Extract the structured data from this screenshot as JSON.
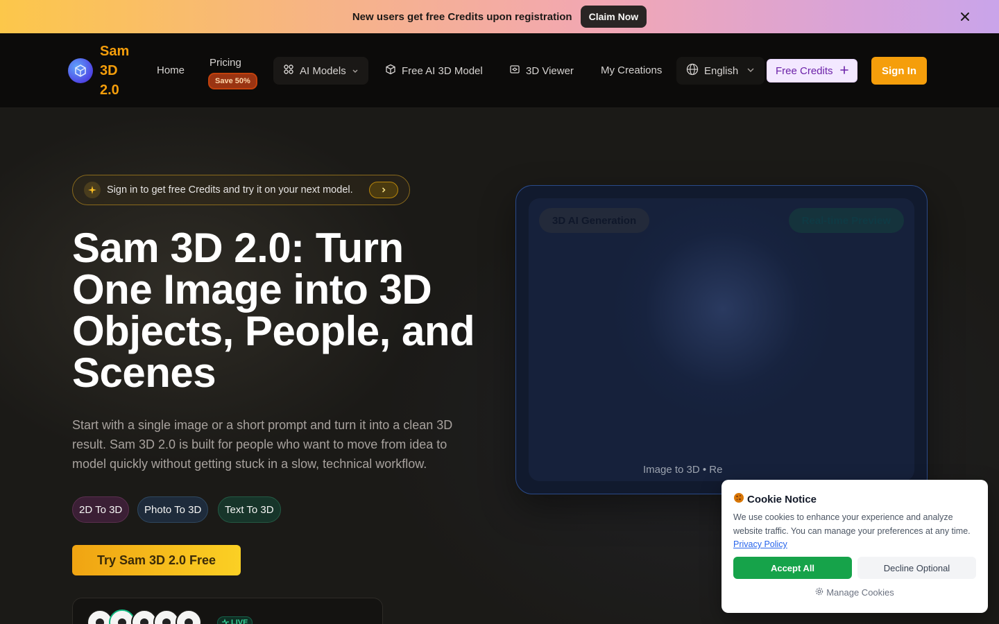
{
  "promo": {
    "text": "New users get free Credits upon registration",
    "button": "Claim Now"
  },
  "nav": {
    "brand_line1": "Sam",
    "brand_line2": "3D",
    "brand_line3": "2.0",
    "home": "Home",
    "pricing": "Pricing",
    "pricing_badge": "Save 50%",
    "ai_models": "AI Models",
    "free_model": "Free AI 3D Model",
    "viewer": "3D Viewer",
    "creations": "My Creations",
    "language": "English",
    "free_credits": "Free Credits",
    "sign_in": "Sign In"
  },
  "hero": {
    "signin_prompt": "Sign in to get free Credits and try it on your next model.",
    "title": "Sam 3D 2.0: Turn One Image into 3D Objects, People, and Scenes",
    "description": "Start with a single image or a short prompt and turn it into a clean 3D result. Sam 3D 2.0 is built for people who want to move from idea to model quickly without getting stuck in a slow, technical workflow.",
    "tags": [
      "2D To 3D",
      "Photo To 3D",
      "Text To 3D"
    ],
    "cta": "Try Sam 3D 2.0 Free",
    "live": "LIVE"
  },
  "preview": {
    "chip_left": "3D AI Generation",
    "chip_right": "Real-time Preview",
    "caption": "Image to 3D • Re"
  },
  "cookie": {
    "title": "Cookie Notice",
    "body": "We use cookies to enhance your experience and analyze website traffic. You can manage your preferences at any time.",
    "link": "Privacy Policy",
    "accept": "Accept All",
    "decline": "Decline Optional",
    "manage": "Manage Cookies"
  },
  "colors": {
    "accent": "#f59e0b",
    "background": "#1b1a17",
    "accept_green": "#16a34a"
  },
  "icons": [
    "close-icon",
    "cube-logo-icon",
    "grid-icon",
    "chevron-down-icon",
    "box-icon",
    "viewer-icon",
    "globe-icon",
    "plus-icon",
    "sparkle-icon",
    "chevron-right-icon",
    "pulse-icon",
    "cookie-icon",
    "gear-icon"
  ]
}
